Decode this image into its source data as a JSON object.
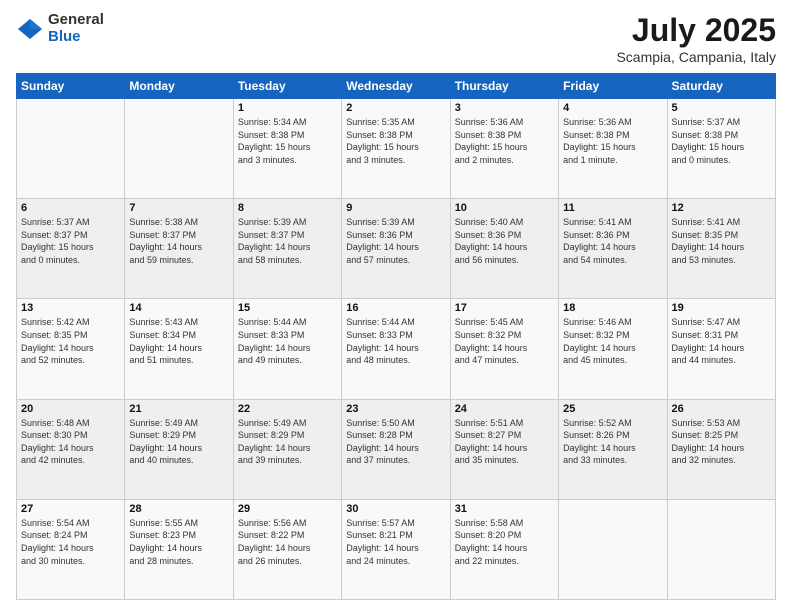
{
  "logo": {
    "general": "General",
    "blue": "Blue"
  },
  "title": "July 2025",
  "subtitle": "Scampia, Campania, Italy",
  "days_of_week": [
    "Sunday",
    "Monday",
    "Tuesday",
    "Wednesday",
    "Thursday",
    "Friday",
    "Saturday"
  ],
  "weeks": [
    [
      {
        "day": "",
        "info": ""
      },
      {
        "day": "",
        "info": ""
      },
      {
        "day": "1",
        "info": "Sunrise: 5:34 AM\nSunset: 8:38 PM\nDaylight: 15 hours\nand 3 minutes."
      },
      {
        "day": "2",
        "info": "Sunrise: 5:35 AM\nSunset: 8:38 PM\nDaylight: 15 hours\nand 3 minutes."
      },
      {
        "day": "3",
        "info": "Sunrise: 5:36 AM\nSunset: 8:38 PM\nDaylight: 15 hours\nand 2 minutes."
      },
      {
        "day": "4",
        "info": "Sunrise: 5:36 AM\nSunset: 8:38 PM\nDaylight: 15 hours\nand 1 minute."
      },
      {
        "day": "5",
        "info": "Sunrise: 5:37 AM\nSunset: 8:38 PM\nDaylight: 15 hours\nand 0 minutes."
      }
    ],
    [
      {
        "day": "6",
        "info": "Sunrise: 5:37 AM\nSunset: 8:37 PM\nDaylight: 15 hours\nand 0 minutes."
      },
      {
        "day": "7",
        "info": "Sunrise: 5:38 AM\nSunset: 8:37 PM\nDaylight: 14 hours\nand 59 minutes."
      },
      {
        "day": "8",
        "info": "Sunrise: 5:39 AM\nSunset: 8:37 PM\nDaylight: 14 hours\nand 58 minutes."
      },
      {
        "day": "9",
        "info": "Sunrise: 5:39 AM\nSunset: 8:36 PM\nDaylight: 14 hours\nand 57 minutes."
      },
      {
        "day": "10",
        "info": "Sunrise: 5:40 AM\nSunset: 8:36 PM\nDaylight: 14 hours\nand 56 minutes."
      },
      {
        "day": "11",
        "info": "Sunrise: 5:41 AM\nSunset: 8:36 PM\nDaylight: 14 hours\nand 54 minutes."
      },
      {
        "day": "12",
        "info": "Sunrise: 5:41 AM\nSunset: 8:35 PM\nDaylight: 14 hours\nand 53 minutes."
      }
    ],
    [
      {
        "day": "13",
        "info": "Sunrise: 5:42 AM\nSunset: 8:35 PM\nDaylight: 14 hours\nand 52 minutes."
      },
      {
        "day": "14",
        "info": "Sunrise: 5:43 AM\nSunset: 8:34 PM\nDaylight: 14 hours\nand 51 minutes."
      },
      {
        "day": "15",
        "info": "Sunrise: 5:44 AM\nSunset: 8:33 PM\nDaylight: 14 hours\nand 49 minutes."
      },
      {
        "day": "16",
        "info": "Sunrise: 5:44 AM\nSunset: 8:33 PM\nDaylight: 14 hours\nand 48 minutes."
      },
      {
        "day": "17",
        "info": "Sunrise: 5:45 AM\nSunset: 8:32 PM\nDaylight: 14 hours\nand 47 minutes."
      },
      {
        "day": "18",
        "info": "Sunrise: 5:46 AM\nSunset: 8:32 PM\nDaylight: 14 hours\nand 45 minutes."
      },
      {
        "day": "19",
        "info": "Sunrise: 5:47 AM\nSunset: 8:31 PM\nDaylight: 14 hours\nand 44 minutes."
      }
    ],
    [
      {
        "day": "20",
        "info": "Sunrise: 5:48 AM\nSunset: 8:30 PM\nDaylight: 14 hours\nand 42 minutes."
      },
      {
        "day": "21",
        "info": "Sunrise: 5:49 AM\nSunset: 8:29 PM\nDaylight: 14 hours\nand 40 minutes."
      },
      {
        "day": "22",
        "info": "Sunrise: 5:49 AM\nSunset: 8:29 PM\nDaylight: 14 hours\nand 39 minutes."
      },
      {
        "day": "23",
        "info": "Sunrise: 5:50 AM\nSunset: 8:28 PM\nDaylight: 14 hours\nand 37 minutes."
      },
      {
        "day": "24",
        "info": "Sunrise: 5:51 AM\nSunset: 8:27 PM\nDaylight: 14 hours\nand 35 minutes."
      },
      {
        "day": "25",
        "info": "Sunrise: 5:52 AM\nSunset: 8:26 PM\nDaylight: 14 hours\nand 33 minutes."
      },
      {
        "day": "26",
        "info": "Sunrise: 5:53 AM\nSunset: 8:25 PM\nDaylight: 14 hours\nand 32 minutes."
      }
    ],
    [
      {
        "day": "27",
        "info": "Sunrise: 5:54 AM\nSunset: 8:24 PM\nDaylight: 14 hours\nand 30 minutes."
      },
      {
        "day": "28",
        "info": "Sunrise: 5:55 AM\nSunset: 8:23 PM\nDaylight: 14 hours\nand 28 minutes."
      },
      {
        "day": "29",
        "info": "Sunrise: 5:56 AM\nSunset: 8:22 PM\nDaylight: 14 hours\nand 26 minutes."
      },
      {
        "day": "30",
        "info": "Sunrise: 5:57 AM\nSunset: 8:21 PM\nDaylight: 14 hours\nand 24 minutes."
      },
      {
        "day": "31",
        "info": "Sunrise: 5:58 AM\nSunset: 8:20 PM\nDaylight: 14 hours\nand 22 minutes."
      },
      {
        "day": "",
        "info": ""
      },
      {
        "day": "",
        "info": ""
      }
    ]
  ]
}
